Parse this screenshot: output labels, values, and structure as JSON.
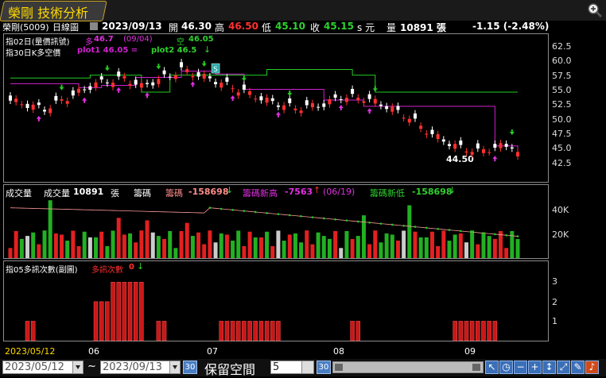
{
  "title": "榮剛 技術分析",
  "quote": {
    "name": "榮剛(5009)",
    "period": "日線圖",
    "date": "2023/09/13",
    "open_label": "開",
    "open": "46.30",
    "high_label": "高",
    "high": "46.50",
    "low_label": "低",
    "low": "45.10",
    "close_label": "收",
    "close": "45.15",
    "unit": "s 元",
    "vol_label": "量",
    "volume": "10891 張",
    "change": "-1.15 (-2.48%)"
  },
  "panel1": {
    "indicator1": "指02日(量價訊號)",
    "indicator2": "指30日K多空價",
    "long_label": "多",
    "long_value": "46.7",
    "long_date": "(09/04)",
    "short_label": "空",
    "short_value": "46.05",
    "plot1_label": "plot1 46.05 =",
    "plot2_label": "plot2 46.5",
    "low_annotation": "44.50",
    "s_marker": "S",
    "y_ticks": [
      "62.5",
      "60.0",
      "57.5",
      "55.0",
      "52.5",
      "50.0",
      "47.5",
      "45.0",
      "42.5"
    ]
  },
  "panel2": {
    "title": "成交量",
    "vol_label": "成交量",
    "vol_value": "10891",
    "unit": "張",
    "chip_label": "籌碼",
    "chip_value": "-158698",
    "chip_high_label": "籌碼新高",
    "chip_high_value": "-7563",
    "chip_high_date": "(06/19)",
    "chip_low_label": "籌碼新低",
    "chip_low_value": "-158698",
    "y_ticks": [
      "40K",
      "20K"
    ]
  },
  "panel3": {
    "title": "指05多訊次數(副圖)",
    "series_label": "多訊次數",
    "series_value": "0",
    "y_ticks": [
      "3",
      "2",
      "1"
    ]
  },
  "x_axis": {
    "start": "2023/05/12",
    "labels": [
      "06",
      "07",
      "08",
      "09"
    ]
  },
  "controls": {
    "from_date": "2023/05/12",
    "to_date": "2023/09/13",
    "separator": "~",
    "btn1": "30",
    "reserve_label": "保留空間",
    "reserve_value": "5",
    "btn2": "30"
  },
  "colors": {
    "up": "#d61a1a",
    "down": "#ffffff",
    "short_line": "#22cc22",
    "plot1_line": "#d020d0",
    "accent": "#ffd800"
  },
  "chart_data": [
    {
      "type": "candlestick",
      "title": "",
      "series": [
        {
          "name": "K線",
          "ohlc_close_approx": [
            54.5,
            56.0,
            58.5,
            61.0,
            59.5,
            57.5,
            60.0,
            57.0,
            56.0,
            53.5,
            54.5,
            52.5,
            47.5,
            46.0,
            45.5,
            46.5,
            47.0,
            46.5,
            45.15
          ]
        }
      ],
      "ylim": [
        41.0,
        64.0
      ]
    },
    {
      "type": "bar",
      "title": "",
      "series": [
        {
          "name": "成交量"
        }
      ],
      "ylim": [
        0,
        48000
      ]
    },
    {
      "type": "bar",
      "title": "",
      "series": [
        {
          "name": "多訊次數"
        }
      ],
      "ylim": [
        0,
        3.5
      ]
    }
  ]
}
